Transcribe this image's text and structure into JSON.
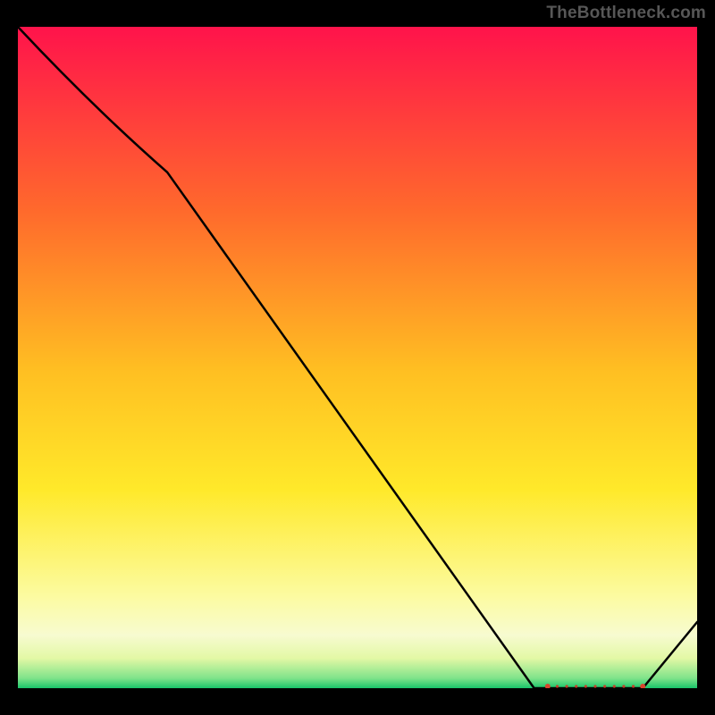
{
  "watermark": "TheBottleneck.com",
  "chart_data": {
    "type": "line",
    "x": [
      0,
      22,
      76,
      80,
      85,
      92,
      100
    ],
    "values": [
      100,
      78,
      0,
      0,
      0,
      0,
      10
    ],
    "title": "",
    "xlabel": "",
    "ylabel": "",
    "xlim": [
      0,
      100
    ],
    "ylim": [
      0,
      100
    ]
  },
  "gradient": {
    "stops": [
      {
        "offset": 0.0,
        "color": "#ff134b"
      },
      {
        "offset": 0.28,
        "color": "#ff6a2c"
      },
      {
        "offset": 0.52,
        "color": "#ffbf22"
      },
      {
        "offset": 0.7,
        "color": "#ffe92a"
      },
      {
        "offset": 0.86,
        "color": "#fcfba0"
      },
      {
        "offset": 0.92,
        "color": "#f7fbd0"
      },
      {
        "offset": 0.955,
        "color": "#e3f8a5"
      },
      {
        "offset": 0.985,
        "color": "#7fe38a"
      },
      {
        "offset": 1.0,
        "color": "#19c46a"
      }
    ]
  }
}
